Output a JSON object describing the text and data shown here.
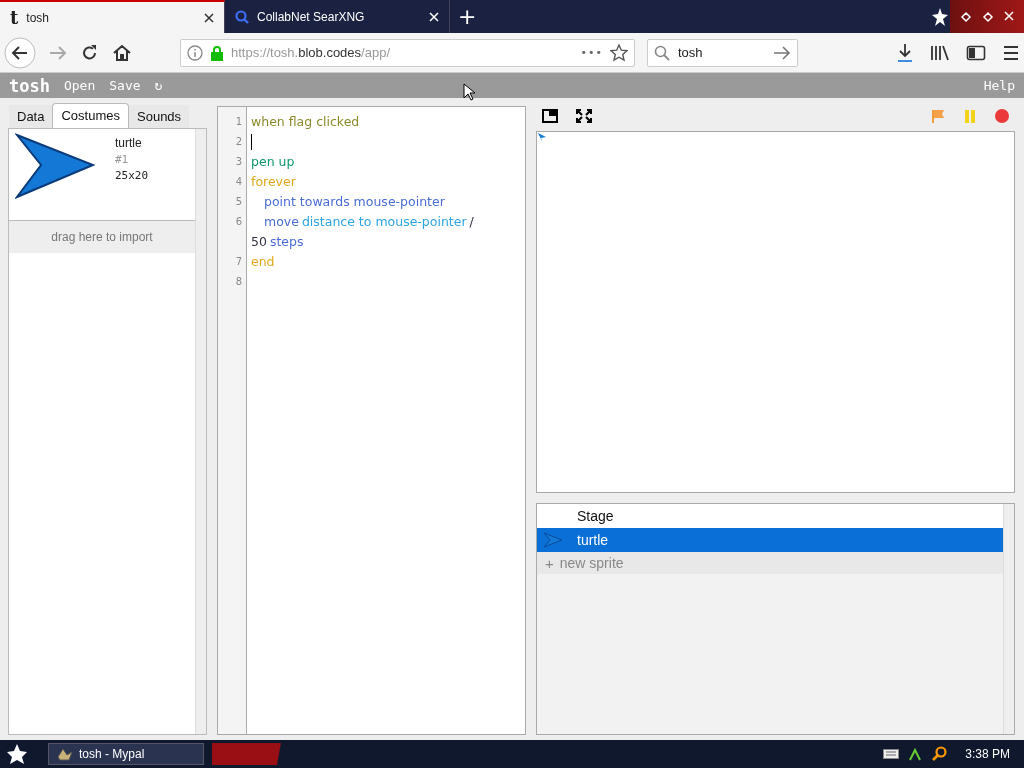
{
  "browser_tabs": [
    {
      "title": "tosh",
      "icon": "t",
      "selected": true
    },
    {
      "title": "CollabNet SearXNG",
      "selected": false
    }
  ],
  "new_tab": "+",
  "address_bar": {
    "url_parts": [
      {
        "text": "https://tosh.",
        "strong": false
      },
      {
        "text": "blob.codes",
        "strong": true
      },
      {
        "text": "/app/",
        "strong": false
      }
    ],
    "more": "•••"
  },
  "search_field": {
    "value": "tosh"
  },
  "app_bar": {
    "logo": "tosh",
    "menu": [
      "Open",
      "Save"
    ],
    "refresh": "↻",
    "help": "Help"
  },
  "side_tabs": [
    {
      "label": "Data",
      "selected": false
    },
    {
      "label": "Costumes",
      "selected": true
    },
    {
      "label": "Sounds",
      "selected": false
    }
  ],
  "costumes": [
    {
      "name": "turtle",
      "index": "#1",
      "size": "25x20"
    }
  ],
  "import_hint": "drag here to import",
  "code_lines": [
    {
      "number": "1",
      "kind": "code",
      "tokens": [
        {
          "text": "when flag clicked",
          "kind": "event"
        }
      ]
    },
    {
      "number": "2",
      "kind": "cursor"
    },
    {
      "number": "3",
      "kind": "code",
      "tokens": [
        {
          "text": "pen up",
          "kind": "pen"
        }
      ]
    },
    {
      "number": "4",
      "kind": "code",
      "tokens": [
        {
          "text": "forever",
          "kind": "control"
        }
      ],
      "children": [
        {
          "number": "5",
          "kind": "code",
          "tokens": [
            {
              "text": "point towards mouse-pointer",
              "kind": "motion"
            }
          ]
        },
        {
          "number": "6",
          "kind": "code",
          "tokens": [
            {
              "text": "move",
              "kind": "motion"
            },
            {
              "text": "distance to mouse-pointer",
              "kind": "sensing"
            },
            {
              "text": "/ 50",
              "kind": "operator"
            },
            {
              "text": "steps",
              "kind": "motion"
            }
          ]
        }
      ]
    },
    {
      "number": "7",
      "kind": "code",
      "tokens": [
        {
          "text": "end",
          "kind": "control"
        }
      ]
    },
    {
      "number": "8",
      "kind": "blank"
    }
  ],
  "sprites": [
    {
      "name": "Stage",
      "selected": false
    },
    {
      "name": "turtle",
      "selected": true
    }
  ],
  "new_sprite": {
    "icon": "+",
    "label": "new sprite"
  },
  "taskbar": {
    "task": "tosh - Mypal",
    "time": "3:38 PM"
  }
}
